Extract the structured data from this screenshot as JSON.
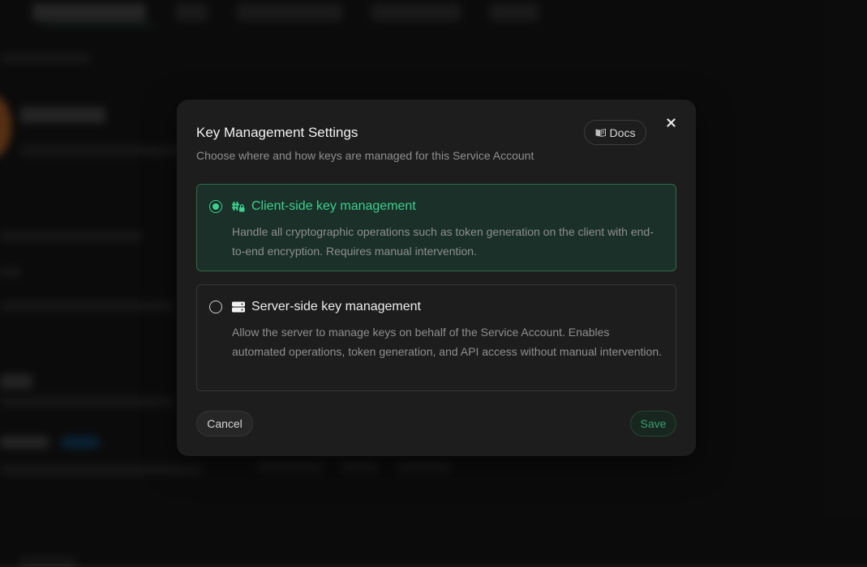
{
  "modal": {
    "title": "Key Management Settings",
    "subtitle": "Choose where and how keys are managed for this Service Account",
    "docs_label": "Docs",
    "cancel_label": "Cancel",
    "save_label": "Save"
  },
  "options": [
    {
      "title": "Client-side key management",
      "description": "Handle all cryptographic operations such as token generation on the client with end-to-end encryption. Requires manual intervention.",
      "selected": true,
      "icon": "client-key-icon"
    },
    {
      "title": "Server-side key management",
      "description": "Allow the server to manage keys on behalf of the Service Account. Enables automated operations, token generation, and API access without manual intervention.",
      "selected": false,
      "icon": "server-icon"
    }
  ],
  "colors": {
    "accent": "#3ecf8e",
    "modal_bg": "#1d1d1d",
    "selected_bg": "#1a3028"
  }
}
